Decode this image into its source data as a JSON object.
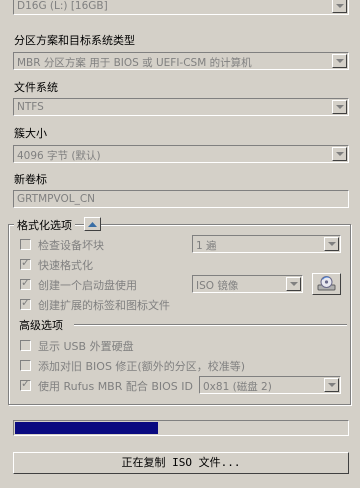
{
  "device": {
    "value": "D16G (L:) [16GB]"
  },
  "partition": {
    "label": "分区方案和目标系统类型",
    "value": "MBR 分区方案 用于 BIOS 或 UEFI-CSM 的计算机"
  },
  "filesystem": {
    "label": "文件系统",
    "value": "NTFS"
  },
  "cluster": {
    "label": "簇大小",
    "value": "4096 字节 (默认)"
  },
  "volume": {
    "label": "新卷标",
    "value": "GRTMPVOL_CN"
  },
  "format_options": {
    "title": "格式化选项",
    "check_bad_blocks": {
      "label": "检查设备坏块",
      "checked": false,
      "passes": "1 遍"
    },
    "quick_format": {
      "label": "快速格式化",
      "checked": true
    },
    "create_bootable": {
      "label": "创建一个启动盘使用",
      "checked": true,
      "type": "ISO 镜像"
    },
    "extended_label": {
      "label": "创建扩展的标签和图标文件",
      "checked": true
    }
  },
  "advanced": {
    "title": "高级选项",
    "show_usb": {
      "label": "显示 USB 外置硬盘",
      "checked": false
    },
    "old_bios": {
      "label": "添加对旧 BIOS 修正(额外的分区，校准等)",
      "checked": false
    },
    "rufus_mbr": {
      "label": "使用 Rufus MBR 配合 BIOS ID",
      "checked": true,
      "bios_id": "0x81 (磁盘 2)"
    }
  },
  "progress": {
    "fraction": 0.43,
    "status": "正在复制 ISO 文件..."
  },
  "colors": {
    "background": "#d4d0c8",
    "progress_fill": "#0a0a80",
    "disabled_text": "#808080"
  },
  "icons": {
    "toggle": "chevron-up-icon",
    "drive": "drive-disc-icon"
  }
}
